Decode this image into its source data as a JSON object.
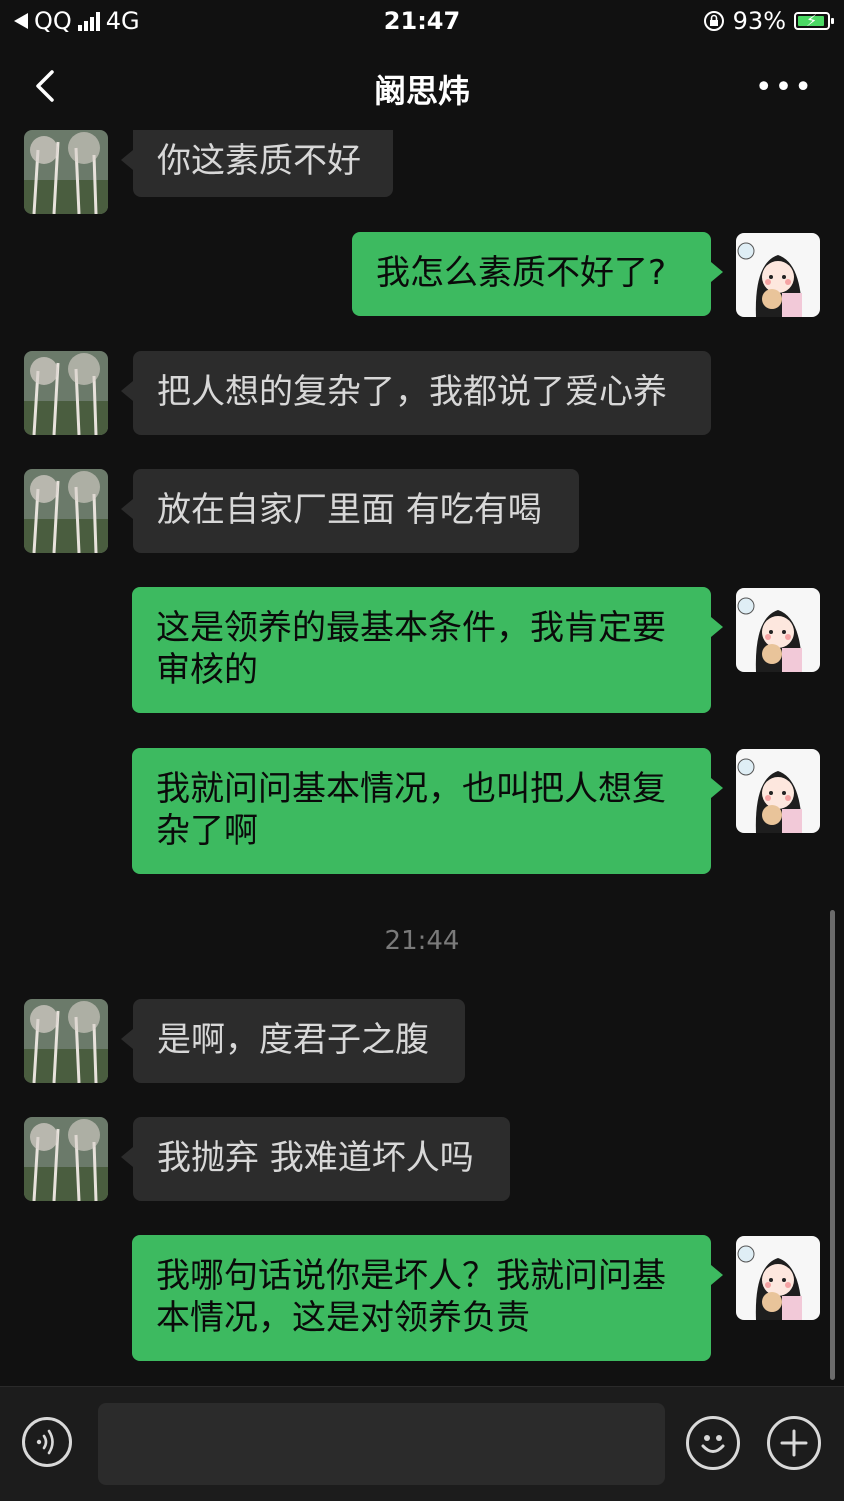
{
  "status_bar": {
    "back_app": "QQ",
    "network": "4G",
    "time": "21:47",
    "battery_percent": "93%",
    "battery_level": 0.93,
    "icons": [
      "back-triangle-icon",
      "signal-icon",
      "rotation-lock-icon",
      "battery-charging-icon"
    ]
  },
  "nav": {
    "title": "阚思炜",
    "more": "•••"
  },
  "messages": [
    {
      "side": "in",
      "text": "你这素质不好"
    },
    {
      "side": "out",
      "text": "我怎么素质不好了?"
    },
    {
      "side": "in",
      "text": "把人想的复杂了，我都说了爱心养"
    },
    {
      "side": "in",
      "text": "放在自家厂里面 有吃有喝"
    },
    {
      "side": "out",
      "text": "这是领养的最基本条件，我肯定要审核的"
    },
    {
      "side": "out",
      "text": "我就问问基本情况，也叫把人想复杂了啊"
    },
    {
      "side": "time",
      "text": "21:44"
    },
    {
      "side": "in",
      "text": "是啊，度君子之腹"
    },
    {
      "side": "in",
      "text": "我抛弃 我难道坏人吗"
    },
    {
      "side": "out",
      "text": "我哪句话说你是坏人？我就问问基本情况，这是对领养负责"
    }
  ],
  "input_bar": {
    "placeholder": "",
    "icons": [
      "voice-icon",
      "emoji-icon",
      "plus-icon"
    ]
  },
  "colors": {
    "background": "#111111",
    "incoming_bubble": "#2c2c2c",
    "outgoing_bubble": "#3dba60",
    "battery_fill": "#4bd964"
  }
}
